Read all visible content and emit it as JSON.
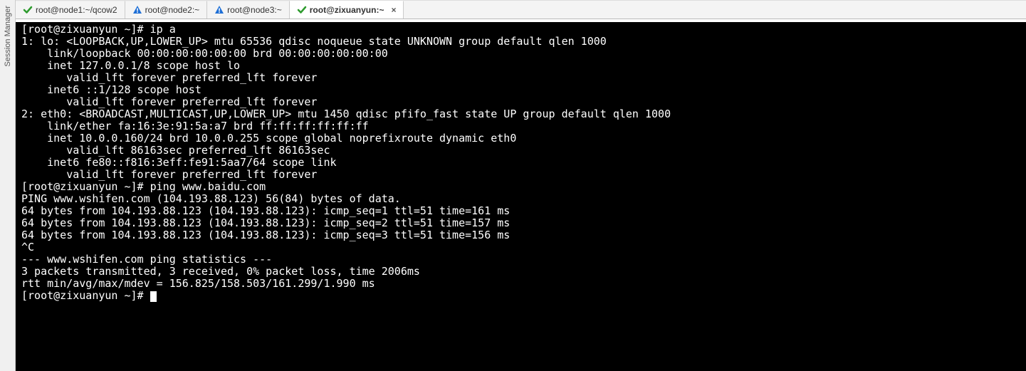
{
  "sidebar_label": "Session Manager",
  "tabs": [
    {
      "label": "root@node1:~/qcow2",
      "icon": "check",
      "active": false,
      "closable": false
    },
    {
      "label": "root@node2:~",
      "icon": "alert",
      "active": false,
      "closable": false
    },
    {
      "label": "root@node3:~",
      "icon": "alert",
      "active": false,
      "closable": false
    },
    {
      "label": "root@zixuanyun:~",
      "icon": "check",
      "active": true,
      "closable": true
    }
  ],
  "close_glyph": "×",
  "terminal_lines": [
    "[root@zixuanyun ~]# ip a",
    "1: lo: <LOOPBACK,UP,LOWER_UP> mtu 65536 qdisc noqueue state UNKNOWN group default qlen 1000",
    "    link/loopback 00:00:00:00:00:00 brd 00:00:00:00:00:00",
    "    inet 127.0.0.1/8 scope host lo",
    "       valid_lft forever preferred_lft forever",
    "    inet6 ::1/128 scope host",
    "       valid_lft forever preferred_lft forever",
    "2: eth0: <BROADCAST,MULTICAST,UP,LOWER_UP> mtu 1450 qdisc pfifo_fast state UP group default qlen 1000",
    "    link/ether fa:16:3e:91:5a:a7 brd ff:ff:ff:ff:ff:ff",
    "    inet 10.0.0.160/24 brd 10.0.0.255 scope global noprefixroute dynamic eth0",
    "       valid_lft 86163sec preferred_lft 86163sec",
    "    inet6 fe80::f816:3eff:fe91:5aa7/64 scope link",
    "       valid_lft forever preferred_lft forever",
    "[root@zixuanyun ~]# ping www.baidu.com",
    "PING www.wshifen.com (104.193.88.123) 56(84) bytes of data.",
    "64 bytes from 104.193.88.123 (104.193.88.123): icmp_seq=1 ttl=51 time=161 ms",
    "64 bytes from 104.193.88.123 (104.193.88.123): icmp_seq=2 ttl=51 time=157 ms",
    "64 bytes from 104.193.88.123 (104.193.88.123): icmp_seq=3 ttl=51 time=156 ms",
    "^C",
    "--- www.wshifen.com ping statistics ---",
    "3 packets transmitted, 3 received, 0% packet loss, time 2006ms",
    "rtt min/avg/max/mdev = 156.825/158.503/161.299/1.990 ms",
    "[root@zixuanyun ~]# "
  ]
}
